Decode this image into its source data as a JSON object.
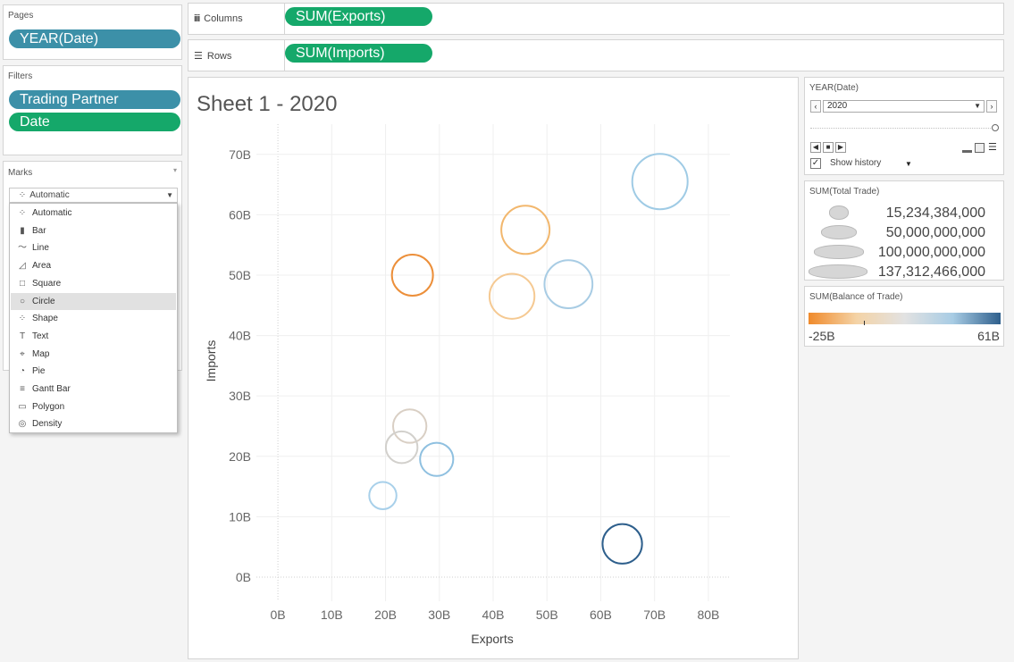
{
  "pages": {
    "title": "Pages",
    "pill": "YEAR(Date)"
  },
  "filters": {
    "title": "Filters",
    "pills": [
      "Trading Partner",
      "Date"
    ]
  },
  "marks": {
    "title": "Marks",
    "selected_type": "Automatic",
    "menu_items": [
      {
        "label": "Automatic",
        "icon": "automatic-icon",
        "selected": false
      },
      {
        "label": "Bar",
        "icon": "bar-icon",
        "selected": false
      },
      {
        "label": "Line",
        "icon": "line-icon",
        "selected": false
      },
      {
        "label": "Area",
        "icon": "area-icon",
        "selected": false
      },
      {
        "label": "Square",
        "icon": "square-icon",
        "selected": false
      },
      {
        "label": "Circle",
        "icon": "circle-icon",
        "selected": true
      },
      {
        "label": "Shape",
        "icon": "shape-icon",
        "selected": false
      },
      {
        "label": "Text",
        "icon": "text-icon",
        "selected": false
      },
      {
        "label": "Map",
        "icon": "map-icon",
        "selected": false
      },
      {
        "label": "Pie",
        "icon": "pie-icon",
        "selected": false
      },
      {
        "label": "Gantt Bar",
        "icon": "gantt-bar-icon",
        "selected": false
      },
      {
        "label": "Polygon",
        "icon": "polygon-icon",
        "selected": false
      },
      {
        "label": "Density",
        "icon": "density-icon",
        "selected": false
      }
    ]
  },
  "shelves": {
    "columns": {
      "label": "Columns",
      "pill": "SUM(Exports)"
    },
    "rows": {
      "label": "Rows",
      "pill": "SUM(Imports)"
    }
  },
  "page_control": {
    "title": "YEAR(Date)",
    "value": "2020",
    "show_history_label": "Show history",
    "show_history_checked": true
  },
  "size_legend": {
    "title": "SUM(Total Trade)",
    "items": [
      "15,234,384,000",
      "50,000,000,000",
      "100,000,000,000",
      "137,312,466,000"
    ]
  },
  "color_legend": {
    "title": "SUM(Balance of Trade)",
    "min_label": "-25B",
    "max_label": "61B",
    "colors": [
      "#f08a2b",
      "#f4d3a6",
      "#e2e2e2",
      "#a8cce4",
      "#2e5f8c"
    ]
  },
  "chart_data": {
    "type": "scatter",
    "title": "Sheet 1 - 2020",
    "xlabel": "Exports",
    "ylabel": "Imports",
    "xlim": [
      -4,
      84
    ],
    "ylim": [
      -4,
      75
    ],
    "x_ticks": [
      "0B",
      "10B",
      "20B",
      "30B",
      "40B",
      "50B",
      "60B",
      "70B",
      "80B"
    ],
    "y_ticks": [
      "0B",
      "10B",
      "20B",
      "30B",
      "40B",
      "50B",
      "60B",
      "70B"
    ],
    "x_tick_values": [
      0,
      10,
      20,
      30,
      40,
      50,
      60,
      70,
      80
    ],
    "y_tick_values": [
      0,
      10,
      20,
      30,
      40,
      50,
      60,
      70
    ],
    "grid": true,
    "points": [
      {
        "x": 71,
        "y": 65.5,
        "total": 136.5,
        "balance": 5.5,
        "color": "#9fcbe5"
      },
      {
        "x": 46,
        "y": 57.5,
        "total": 103.5,
        "balance": -11.5,
        "color": "#f2b76d"
      },
      {
        "x": 25,
        "y": 50,
        "total": 75,
        "balance": -25,
        "color": "#ec8f3a"
      },
      {
        "x": 54,
        "y": 48.5,
        "total": 102.5,
        "balance": 5.5,
        "color": "#a8cce4"
      },
      {
        "x": 43.5,
        "y": 46.5,
        "total": 90,
        "balance": -3,
        "color": "#f5c992"
      },
      {
        "x": 24.5,
        "y": 25,
        "total": 49.5,
        "balance": -0.5,
        "color": "#d9cfc4"
      },
      {
        "x": 23,
        "y": 21.5,
        "total": 44.5,
        "balance": 1.5,
        "color": "#d2d0cc"
      },
      {
        "x": 29.5,
        "y": 19.5,
        "total": 49,
        "balance": 10,
        "color": "#8fc0e0"
      },
      {
        "x": 19.5,
        "y": 13.5,
        "total": 33,
        "balance": 6,
        "color": "#a8d0ea"
      },
      {
        "x": 64,
        "y": 5.5,
        "total": 69.5,
        "balance": 58.5,
        "color": "#2e5f8c"
      }
    ]
  }
}
